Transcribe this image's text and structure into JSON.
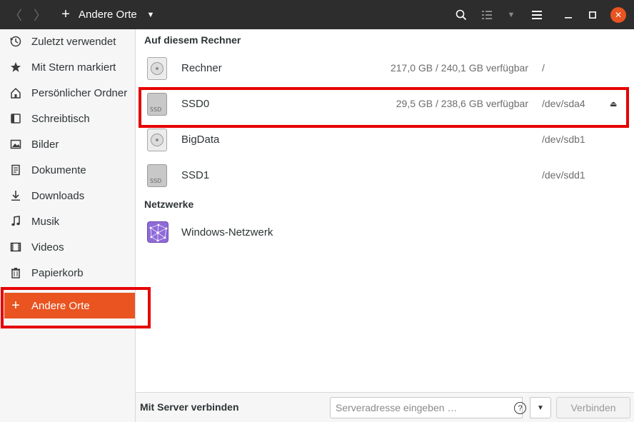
{
  "headerbar": {
    "back_icon": "chevron-left-icon",
    "forward_icon": "chevron-right-icon",
    "path_label": "Andere Orte",
    "search_icon": "search-icon",
    "list_view_icon": "list-view-icon",
    "menu_icon": "hamburger-menu-icon",
    "accent_color": "#e95420"
  },
  "sidebar": {
    "items": [
      {
        "label": "Zuletzt verwendet",
        "icon": "clock-icon"
      },
      {
        "label": "Mit Stern markiert",
        "icon": "star-icon"
      },
      {
        "label": "Persönlicher Ordner",
        "icon": "home-icon"
      },
      {
        "label": "Schreibtisch",
        "icon": "desktop-icon"
      },
      {
        "label": "Bilder",
        "icon": "image-icon"
      },
      {
        "label": "Dokumente",
        "icon": "document-icon"
      },
      {
        "label": "Downloads",
        "icon": "download-icon"
      },
      {
        "label": "Musik",
        "icon": "music-icon"
      },
      {
        "label": "Videos",
        "icon": "video-icon"
      },
      {
        "label": "Papierkorb",
        "icon": "trash-icon"
      },
      {
        "label": "Andere Orte",
        "icon": "plus-icon",
        "active": true
      }
    ]
  },
  "main": {
    "section_computer": "Auf diesem Rechner",
    "devices": [
      {
        "name": "Rechner",
        "space": "217,0 GB / 240,1 GB verfügbar",
        "path": "/",
        "icon": "hdd-icon"
      },
      {
        "name": "SSD0",
        "space": "29,5 GB / 238,6 GB verfügbar",
        "path": "/dev/sda4",
        "icon": "ssd-icon",
        "eject": true
      },
      {
        "name": "BigData",
        "space": "",
        "path": "/dev/sdb1",
        "icon": "hdd-icon"
      },
      {
        "name": "SSD1",
        "space": "",
        "path": "/dev/sdd1",
        "icon": "ssd-icon"
      }
    ],
    "ssd_badge": "SSD",
    "section_network": "Netzwerke",
    "networks": [
      {
        "name": "Windows-Netzwerk",
        "icon": "network-icon"
      }
    ]
  },
  "bottombar": {
    "label": "Mit Server verbinden",
    "input_placeholder": "Serveradresse eingeben …",
    "input_value": "",
    "help_glyph": "?",
    "connect_label": "Verbinden"
  }
}
